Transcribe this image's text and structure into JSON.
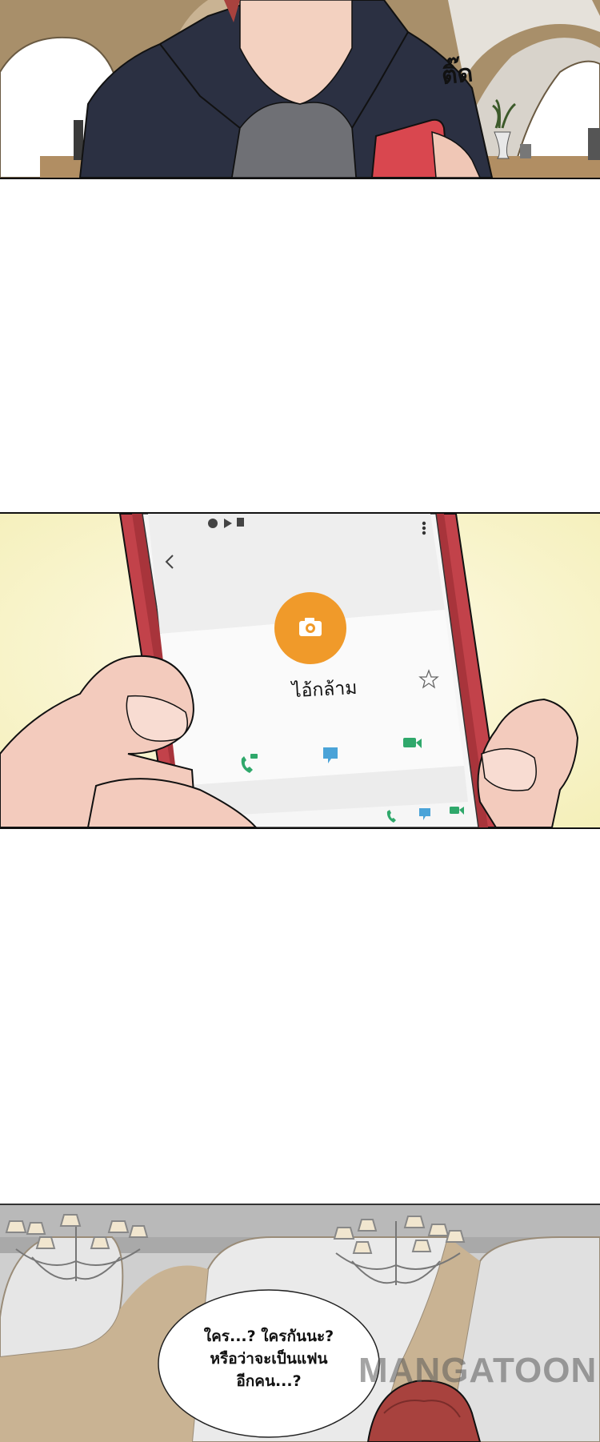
{
  "panel1": {
    "sfx": "ติ๊ด"
  },
  "panel2": {
    "contact_name": "ไอ้กล้าม",
    "icons": [
      "back-arrow-icon",
      "more-vert-icon",
      "camera-icon",
      "star-icon",
      "call-icon",
      "message-icon",
      "video-call-icon"
    ]
  },
  "panel3": {
    "speech_lines": [
      "ใคร...? ใครกันนะ?",
      "หรือว่าจะเป็นแฟน",
      "อีกคน...?"
    ]
  },
  "watermark": "MANGATOON",
  "colors": {
    "phone_red": "#c2424a",
    "camera_orange": "#f09a2a",
    "icon_green": "#2fa86b",
    "icon_blue": "#4aa3d8",
    "jacket_navy": "#2b3042",
    "hair_red": "#a8423e"
  }
}
